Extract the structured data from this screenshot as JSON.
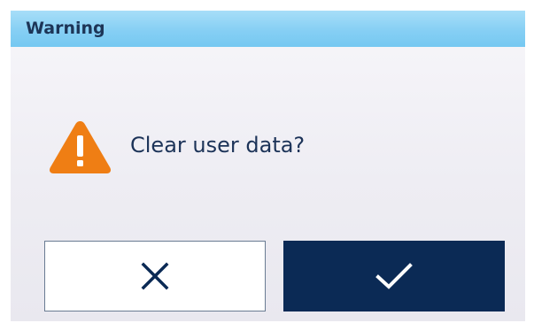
{
  "dialog": {
    "title": "Warning",
    "message": "Clear user data?"
  },
  "buttons": {
    "cancel": {
      "icon": "close-icon"
    },
    "confirm": {
      "icon": "checkmark-icon"
    }
  },
  "colors": {
    "title_bar": "#86cff4",
    "title_text": "#1d3557",
    "warning_icon": "#ef7e14",
    "confirm_button": "#0b2a55",
    "cancel_button_border": "#6a7c93"
  }
}
